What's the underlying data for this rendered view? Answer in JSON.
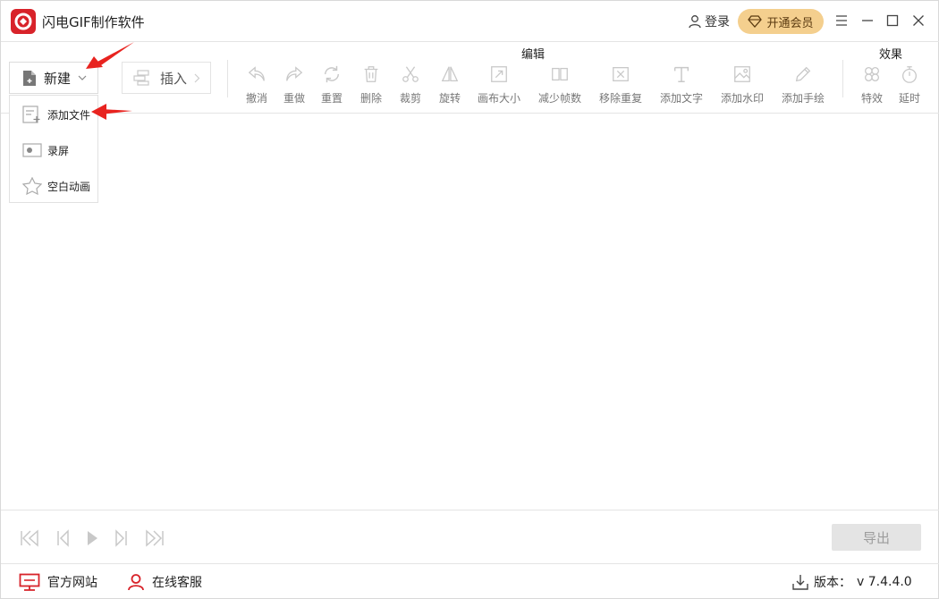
{
  "app": {
    "title": "闪电GIF制作软件"
  },
  "header": {
    "login_label": "登录",
    "vip_label": "开通会员"
  },
  "toolbar": {
    "new_label": "新建",
    "insert_label": "插入",
    "edit_group_label": "编辑",
    "effects_group_label": "效果",
    "tools": [
      {
        "label": "撤消",
        "icon": "undo-icon"
      },
      {
        "label": "重做",
        "icon": "redo-icon"
      },
      {
        "label": "重置",
        "icon": "reset-icon"
      },
      {
        "label": "删除",
        "icon": "trash-icon"
      },
      {
        "label": "裁剪",
        "icon": "scissors-icon"
      },
      {
        "label": "旋转",
        "icon": "rotate-icon"
      },
      {
        "label": "画布大小",
        "icon": "canvas-resize-icon"
      },
      {
        "label": "减少帧数",
        "icon": "reduce-frames-icon"
      },
      {
        "label": "移除重复",
        "icon": "remove-duplicates-icon"
      },
      {
        "label": "添加文字",
        "icon": "text-icon"
      },
      {
        "label": "添加水印",
        "icon": "watermark-icon"
      },
      {
        "label": "添加手绘",
        "icon": "pen-icon"
      }
    ],
    "effects": [
      {
        "label": "特效",
        "icon": "effects-icon"
      },
      {
        "label": "延时",
        "icon": "timer-icon"
      }
    ]
  },
  "dropdown": {
    "items": [
      {
        "label": "添加文件",
        "icon": "add-file-icon"
      },
      {
        "label": "录屏",
        "icon": "screen-record-icon"
      },
      {
        "label": "空白动画",
        "icon": "blank-animation-icon"
      }
    ]
  },
  "playback": {
    "export_label": "导出"
  },
  "statusbar": {
    "website_label": "官方网站",
    "support_label": "在线客服",
    "version_label": "版本：",
    "version_value": "v 7.4.4.0"
  },
  "colors": {
    "brand": "#d8232a",
    "vip_bg": "#f4cf8e",
    "annotation_arrow": "#e8231f",
    "disabled_icon": "#c8c8c8"
  }
}
